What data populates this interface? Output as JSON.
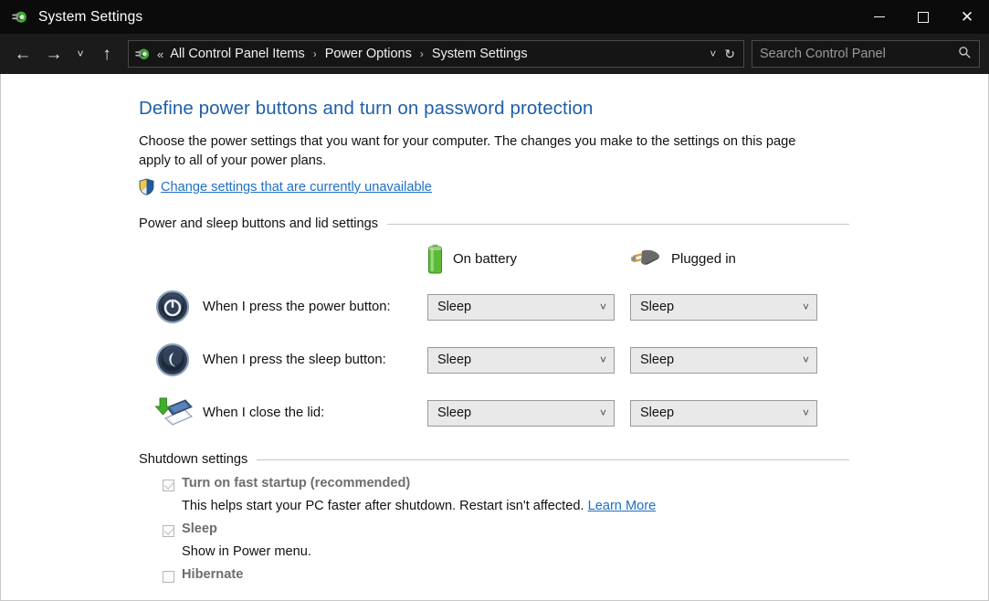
{
  "window": {
    "title": "System Settings",
    "title_icon": "power-plug-icon",
    "controls": {
      "minimize": "–",
      "maximize": "□",
      "close": "✕"
    }
  },
  "navbar": {
    "back": "←",
    "forward": "→",
    "history_chevron": "˅",
    "up": "↑",
    "address_icon": "power-plug-icon",
    "overflow": "«",
    "separator": "›",
    "breadcrumbs": [
      "All Control Panel Items",
      "Power Options",
      "System Settings"
    ],
    "dropdown_chevron": "˅",
    "refresh": "↻",
    "search": {
      "placeholder": "Search Control Panel",
      "value": "",
      "icon": "magnifier-icon"
    }
  },
  "page": {
    "title": "Define power buttons and turn on password protection",
    "description": "Choose the power settings that you want for your computer. The changes you make to the settings on this page apply to all of your power plans.",
    "uac_link": "Change settings that are currently unavailable",
    "uac_icon": "shield-icon"
  },
  "power_section": {
    "header": "Power and sleep buttons and lid settings",
    "columns": [
      {
        "label": "On battery",
        "icon": "battery-icon"
      },
      {
        "label": "Plugged in",
        "icon": "power-plug-icon"
      }
    ],
    "rows": [
      {
        "icon": "power-button-icon",
        "label": "When I press the power button:",
        "on_battery": "Sleep",
        "plugged_in": "Sleep"
      },
      {
        "icon": "sleep-button-icon",
        "label": "When I press the sleep button:",
        "on_battery": "Sleep",
        "plugged_in": "Sleep"
      },
      {
        "icon": "laptop-lid-icon",
        "label": "When I close the lid:",
        "on_battery": "Sleep",
        "plugged_in": "Sleep"
      }
    ],
    "dropdown_chevron": "˅"
  },
  "shutdown_section": {
    "header": "Shutdown settings",
    "items": [
      {
        "label": "Turn on fast startup (recommended)",
        "checked": true,
        "description": "This helps start your PC faster after shutdown. Restart isn't affected.",
        "link": "Learn More"
      },
      {
        "label": "Sleep",
        "checked": true,
        "description": "Show in Power menu.",
        "link": ""
      },
      {
        "label": "Hibernate",
        "checked": false,
        "description": "",
        "link": ""
      }
    ]
  },
  "colors": {
    "titlebar_bg": "#0b0b0b",
    "navbar_bg": "#1b1b1b",
    "heading_blue": "#1f5fa8",
    "link_blue": "#1f6fc4",
    "dropdown_bg": "#e9e9e9",
    "battery_green": "#4fae31",
    "disabled_text": "#6d6d6d"
  }
}
